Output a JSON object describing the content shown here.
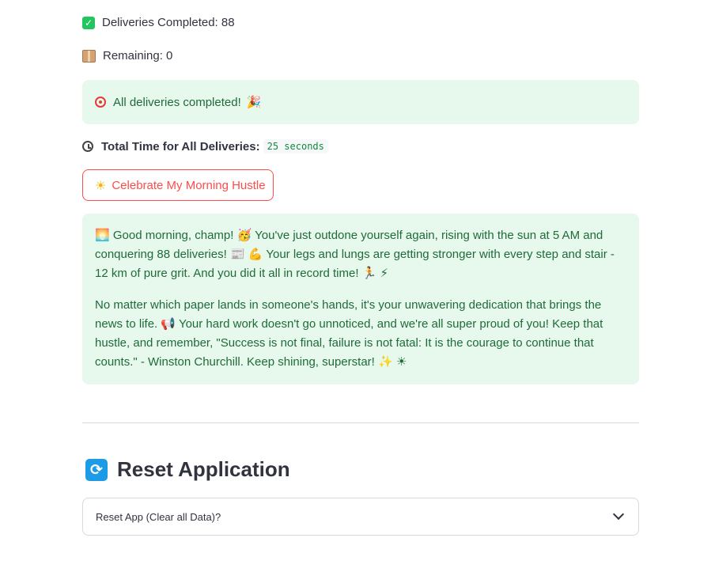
{
  "stats": {
    "completed_label": "Deliveries Completed: 88",
    "remaining_label": "Remaining: 0"
  },
  "alert": {
    "text": "All deliveries completed!",
    "party_icon": "🎉"
  },
  "time": {
    "label": "Total Time for All Deliveries:",
    "value": "25 seconds"
  },
  "celebrate_button": {
    "label": "Celebrate My Morning Hustle",
    "icon": "☀"
  },
  "message": {
    "paragraph1": "🌅 Good morning, champ! 🥳 You've just outdone yourself again, rising with the sun at 5 AM and conquering 88 deliveries! 📰 💪 Your legs and lungs are getting stronger with every step and stair - 12 km of pure grit. And you did it all in record time! 🏃 ⚡",
    "paragraph2": "No matter which paper lands in someone's hands, it's your unwavering dedication that brings the news to life. 📢 Your hard work doesn't go unnoticed, and we're all super proud of you! Keep that hustle, and remember, \"Success is not final, failure is not fatal: It is the courage to continue that counts.\" - Winston Churchill. Keep shining, superstar! ✨ ☀"
  },
  "reset": {
    "title": "Reset Application",
    "icon": "⟳",
    "expander_label": "Reset App (Clear all Data)?"
  },
  "icons": {
    "completed": "check-mark-icon",
    "remaining": "package-icon",
    "alert": "target-icon",
    "time": "clock-icon",
    "expander": "chevron-down-icon"
  },
  "colors": {
    "success_bg": "#e7f8ec",
    "success_text": "#1f6b3a",
    "accent": "#ff4b4b",
    "code_text": "#0f8a3c"
  }
}
